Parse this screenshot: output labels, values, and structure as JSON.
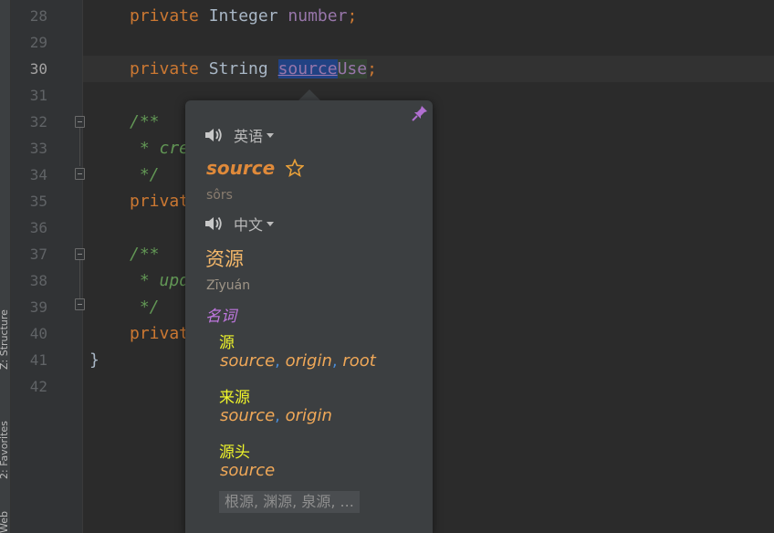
{
  "tool_windows": {
    "structure": "Z: Structure",
    "favorites": "2: Favorites",
    "web": "Web"
  },
  "line_numbers": [
    "28",
    "29",
    "30",
    "31",
    "32",
    "33",
    "34",
    "35",
    "36",
    "37",
    "38",
    "39",
    "40",
    "41",
    "42"
  ],
  "code": {
    "l28": {
      "kw": "private",
      "type": " Integer ",
      "field": "number",
      "end": ";"
    },
    "l30": {
      "kw": "private",
      "type": " String ",
      "sel": "source",
      "rest": "Use",
      "end": ";"
    },
    "l32": "/**",
    "l33": " * cre",
    "l34": " */",
    "l35": "privat",
    "l37": "/**",
    "l38": " * upd",
    "l39": " */",
    "l40": "privat",
    "l41": "}"
  },
  "translation_popup": {
    "source_lang": "英语",
    "word": "source",
    "phonetic": "sôrs",
    "target_lang": "中文",
    "translation": "资源",
    "translation_pinyin": "Zīyuán",
    "part_of_speech": "名词",
    "entries": [
      {
        "word": "源",
        "synonyms": [
          "source",
          "origin",
          "root"
        ]
      },
      {
        "word": "来源",
        "synonyms": [
          "source",
          "origin"
        ]
      },
      {
        "word": "源头",
        "synonyms": [
          "source"
        ]
      }
    ],
    "more": "根源, 渊源, 泉源, ..."
  },
  "colors": {
    "keyword": "#cc7832",
    "field": "#9876aa",
    "comment": "#629755",
    "word": "#e08a3a",
    "translation": "#f5b86a",
    "pos": "#c077e0",
    "entry_word": "#eef42a"
  },
  "icons": {
    "pin": "pin-icon",
    "speaker": "speaker-icon",
    "star": "star-icon"
  }
}
